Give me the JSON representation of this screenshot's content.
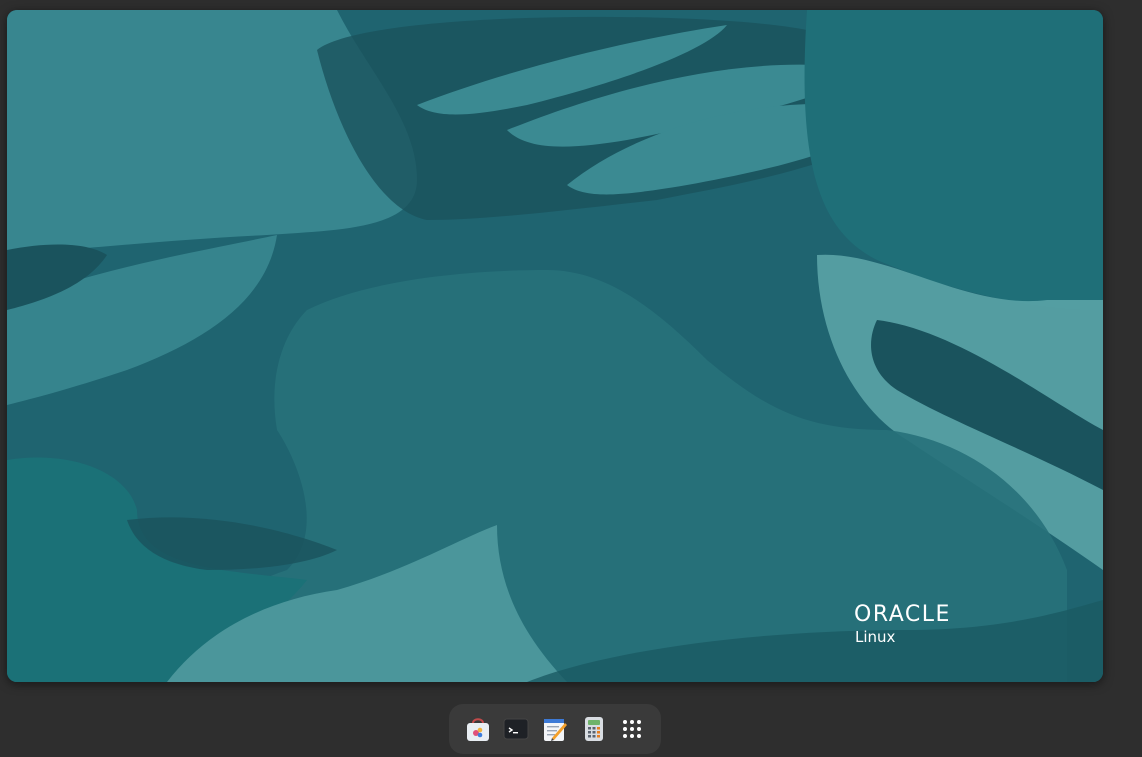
{
  "desktop": {
    "wallpaper": {
      "brand": "ORACLE",
      "product": "Linux",
      "base_color": "#1f6470",
      "light_color": "#3b8a92",
      "dark_color": "#1a535d"
    }
  },
  "dash": {
    "items": [
      {
        "name": "software-store",
        "icon": "shopping-bag-icon"
      },
      {
        "name": "terminal",
        "icon": "terminal-icon"
      },
      {
        "name": "text-editor",
        "icon": "text-editor-icon"
      },
      {
        "name": "calculator",
        "icon": "calculator-icon"
      },
      {
        "name": "show-apps",
        "icon": "app-grid-icon"
      }
    ]
  }
}
